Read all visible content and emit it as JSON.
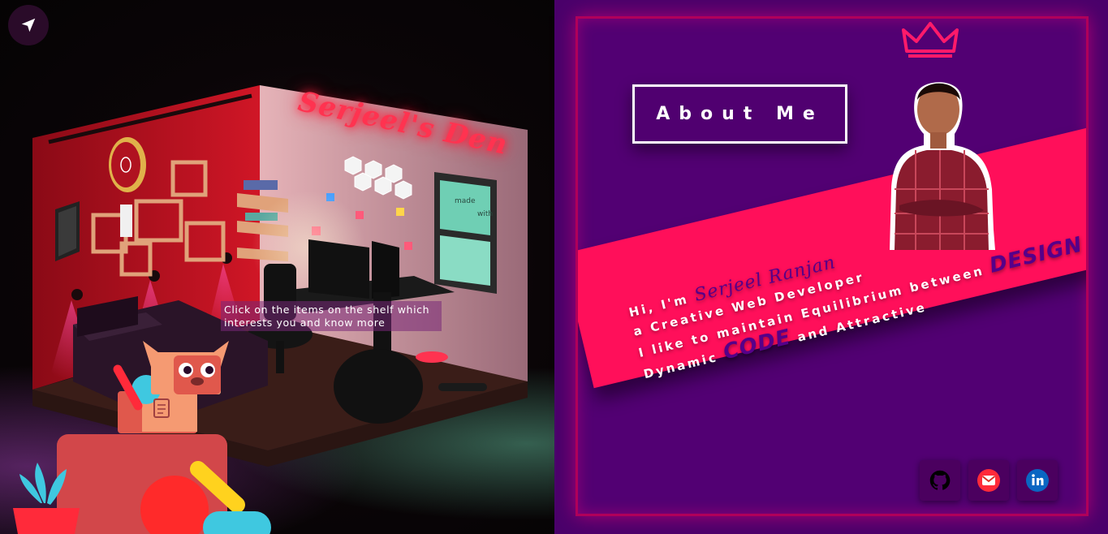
{
  "scene": {
    "tooltip_text": "Click on the items on the shelf which interests you and know more",
    "room_sign": "Serjeel's Den",
    "poster_text_1": "made",
    "poster_text_2": "with"
  },
  "about": {
    "heading": "About Me",
    "intro": {
      "greeting": "Hi, I'm",
      "name": "Serjeel Ranjan",
      "role": "a Creative Web Developer",
      "tagline": "I like to maintain Equilibrium between",
      "dynamic": "Dynamic",
      "code_word": "CODE",
      "and_attractive": "and Attractive",
      "design_word": "DESIGN"
    }
  },
  "socials": [
    {
      "name": "github",
      "icon": "github-icon",
      "color": "#000000"
    },
    {
      "name": "gmail",
      "icon": "gmail-icon",
      "color": "#d93025"
    },
    {
      "name": "linkedin",
      "icon": "linkedin-icon",
      "color": "#0a66c2"
    }
  ],
  "colors": {
    "panel_bg": "#4a006b",
    "accent_pink": "#ff0f5a",
    "neon_red": "#ff3350",
    "name_purple": "#56008a"
  }
}
